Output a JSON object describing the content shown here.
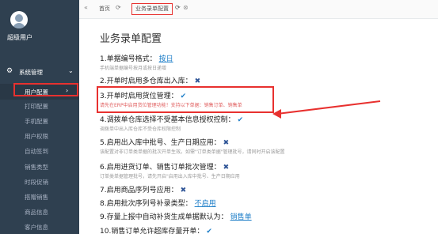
{
  "sidebar": {
    "user_name": "超级用户",
    "group_label": "系统管理",
    "items": [
      {
        "label": "用户配置",
        "active": true
      },
      {
        "label": "打印配置"
      },
      {
        "label": "手机配置"
      },
      {
        "label": "用户权限"
      },
      {
        "label": "自动签到"
      },
      {
        "label": "销售类型"
      },
      {
        "label": "时段促销"
      },
      {
        "label": "搭赠销售"
      },
      {
        "label": "商品信息"
      },
      {
        "label": "客户信息"
      }
    ]
  },
  "tabbar": {
    "home_label": "首页",
    "active_tab_label": "业务录单配置"
  },
  "main": {
    "title": "业务录单配置",
    "settings": [
      {
        "label": "1.单据编号格式：",
        "value": "按日",
        "hint": "手机端单据编号按月或按日递增"
      },
      {
        "label": "2.开单时启用多仓库出入库：",
        "status": "✖"
      },
      {
        "label": "3.开单时启用货位管理：",
        "status": "✔",
        "hint": "请先在ERP中启用货位管理功能！支持以下单据：销售订单、销售单"
      },
      {
        "label": "4.调拨单仓库选择不受基本信息授权控制：",
        "status": "✔",
        "hint": "调拨单中出入库仓库不受仓库权限控制"
      },
      {
        "label": "5.启用出入库中批号、生产日期应用：",
        "status": "✖",
        "hint": "该配置对非订单类单据的批次开单生效。如需\"订单类单据\"管理批号，请同时开启该配置"
      },
      {
        "label": "6.启用进货订单、销售订单批次管理：",
        "status": "✖",
        "hint": "订单类单据管理批号，请先开启\"启用出入库中批号、生产日期应用"
      },
      {
        "label": "7.启用商品序列号应用：",
        "status": "✖"
      },
      {
        "label": "8.启用批次序列号补录类型：",
        "value": "不启用"
      },
      {
        "label": "9.存量上报中自动补货生成单据默认为：",
        "value": "销售单"
      },
      {
        "label": "10.销售订单允许超库存量开单：",
        "status": "✔"
      }
    ]
  }
}
